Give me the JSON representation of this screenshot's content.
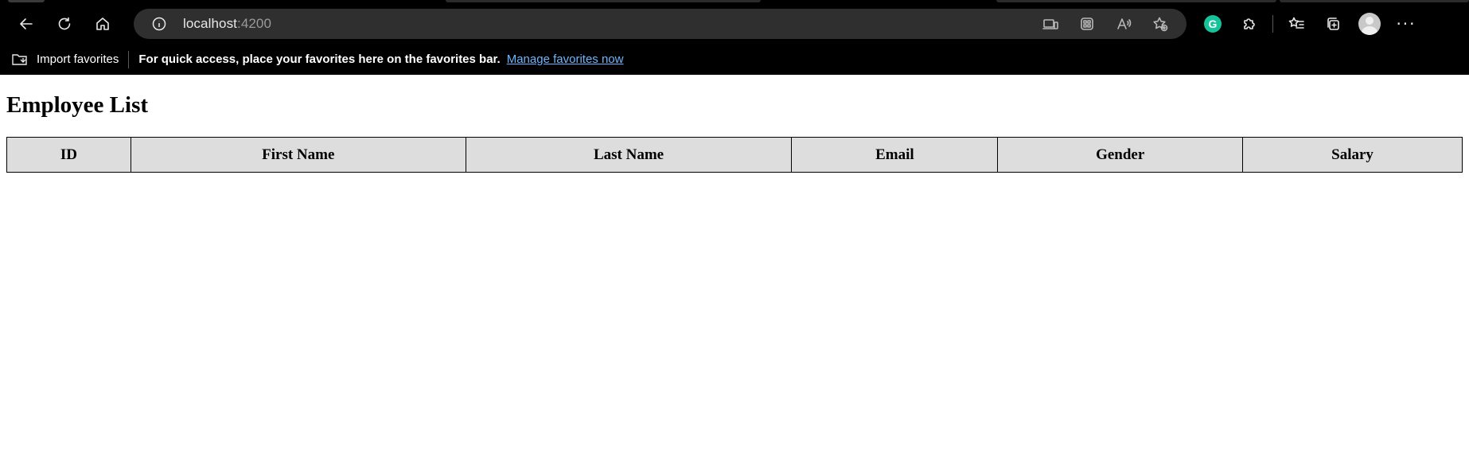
{
  "browser": {
    "address": {
      "host": "localhost",
      "port": ":4200"
    },
    "favorites_bar": {
      "import_label": "Import favorites",
      "message": "For quick access, place your favorites here on the favorites bar.",
      "manage_link": "Manage favorites now"
    },
    "extension_letter": "G",
    "more_label": "···"
  },
  "page": {
    "title": "Employee List",
    "table": {
      "headers": [
        "ID",
        "First Name",
        "Last Name",
        "Email",
        "Gender",
        "Salary"
      ],
      "rows": []
    }
  }
}
